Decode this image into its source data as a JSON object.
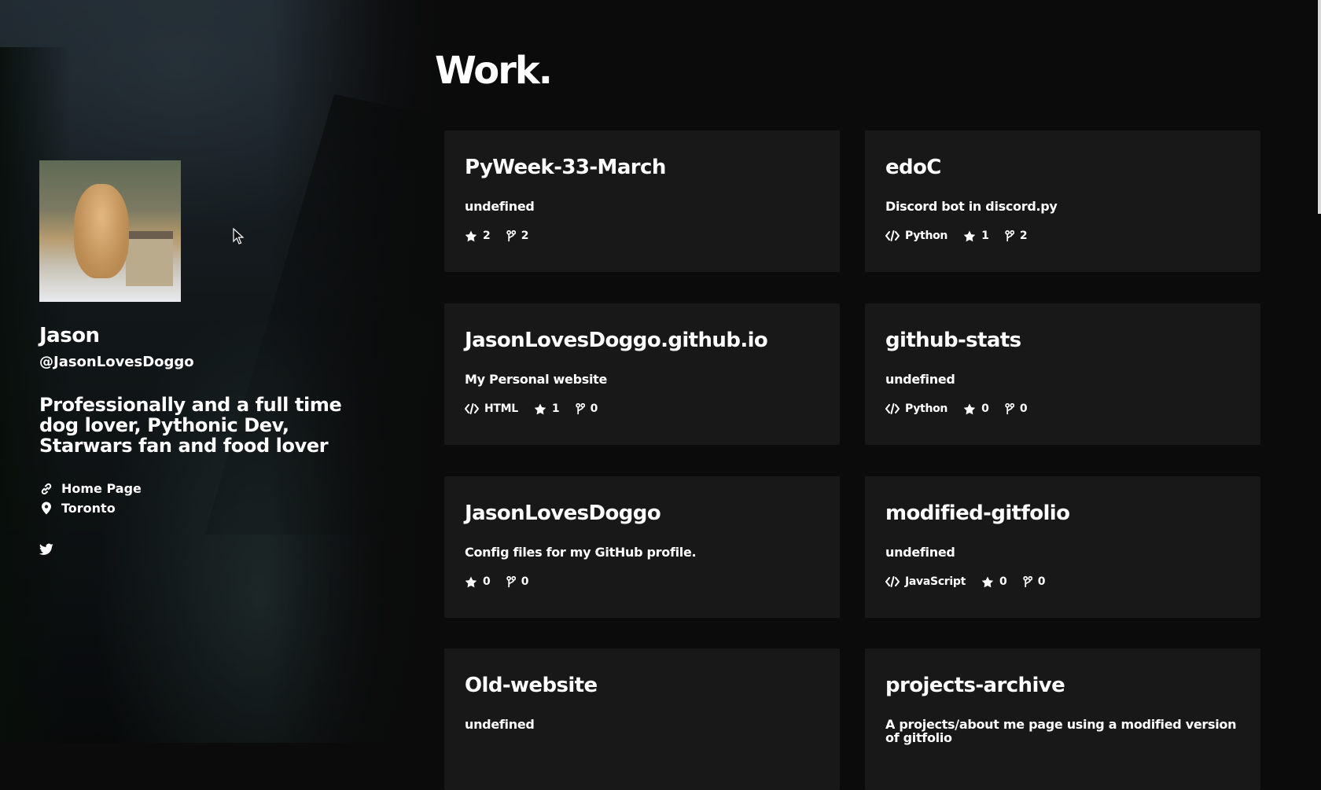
{
  "profile": {
    "name": "Jason",
    "handle": "@JasonLovesDoggo",
    "bio": "Professionally and a full time dog lover, Pythonic Dev, Starwars fan and food lover",
    "homepage_label": "Home Page",
    "location": "Toronto"
  },
  "main": {
    "title": "Work."
  },
  "projects": [
    {
      "name": "PyWeek-33-March",
      "description": "undefined",
      "language": "",
      "stars": "2",
      "forks": "2"
    },
    {
      "name": "edoC",
      "description": "Discord bot in discord.py",
      "language": "Python",
      "stars": "1",
      "forks": "2"
    },
    {
      "name": "JasonLovesDoggo.github.io",
      "description": "My Personal website",
      "language": "HTML",
      "stars": "1",
      "forks": "0"
    },
    {
      "name": "github-stats",
      "description": "undefined",
      "language": "Python",
      "stars": "0",
      "forks": "0"
    },
    {
      "name": "JasonLovesDoggo",
      "description": "Config files for my GitHub profile.",
      "language": "",
      "stars": "0",
      "forks": "0"
    },
    {
      "name": "modified-gitfolio",
      "description": "undefined",
      "language": "JavaScript",
      "stars": "0",
      "forks": "0"
    },
    {
      "name": "Old-website",
      "description": "undefined",
      "language": "",
      "stars": "",
      "forks": ""
    },
    {
      "name": "projects-archive",
      "description": "A projects/about me page using a modified version of gitfolio",
      "language": "",
      "stars": "",
      "forks": ""
    }
  ],
  "icons": {
    "homepage": "link-icon",
    "location": "map-pin-icon",
    "social": "twitter-icon",
    "language": "code-icon",
    "stars": "star-icon",
    "forks": "fork-icon"
  }
}
